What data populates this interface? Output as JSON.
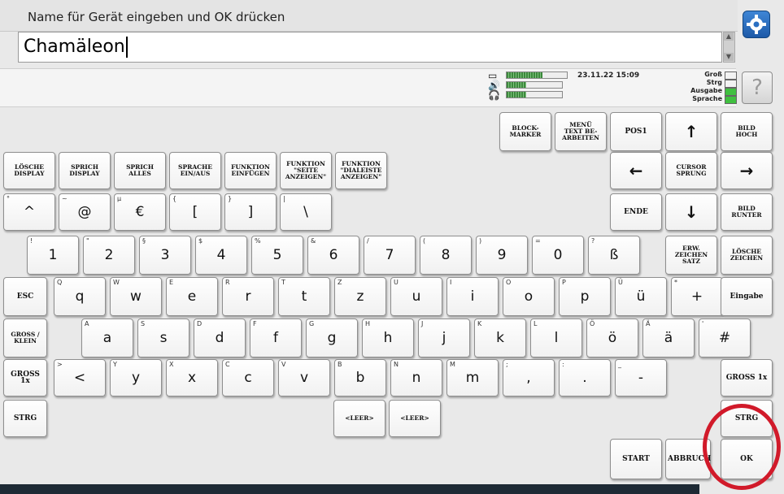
{
  "prompt": "Name für Gerät eingeben und OK drücken",
  "input_value": "Chamäleon",
  "scroll": {
    "up": "▲",
    "down": "▼"
  },
  "help_glyph": "?",
  "status": {
    "datetime": "23.11.22 15:09",
    "meters": [
      {
        "icon": "battery-icon",
        "glyph": "▭",
        "level": 0.6
      },
      {
        "icon": "speaker-icon",
        "glyph": "🔊",
        "level": 0.35
      },
      {
        "icon": "headphones-icon",
        "glyph": "🎧",
        "level": 0.35
      }
    ],
    "flags": [
      {
        "label": "Groß",
        "on": false
      },
      {
        "label": "Strg",
        "on": false
      },
      {
        "label": "Ausgabe",
        "on": true
      },
      {
        "label": "Sprache",
        "on": true
      }
    ],
    "flag_on_color": "#40c040"
  },
  "keys": {
    "block_marker": "BLOCK-\nMARKER",
    "menu_text": "MENÜ\nTEXT BE-\nARBEITEN",
    "pos1": "POS1",
    "up": "↑",
    "page_up": "BILD\nHOCH",
    "clear_display": "LÖSCHE\nDISPLAY",
    "speak_display": "SPRICH\nDISPLAY",
    "speak_all": "SPRICH\nALLES",
    "speech_toggle": "SPRACHE\nEIN/AUS",
    "insert_function": "FUNKTION\nEINFÜGEN",
    "page_function": "FUNKTION\n\"SEITE\nANZEIGEN\"",
    "dialog_function": "FUNKTION\n\"DIALEISTE\nANZEIGEN\"",
    "left": "←",
    "cursor_jump": "CURSOR\nSPRUNG",
    "right": "→",
    "end": "ENDE",
    "down": "↓",
    "page_down": "BILD\nRUNTER",
    "ext_chars": "ERW.\nZEICHEN\nSATZ",
    "delete_chars": "LÖSCHE\nZEICHEN",
    "esc": "ESC",
    "enter": "Eingabe",
    "caps": "GROSS /\nKLEIN",
    "shift_once_left": "GROSS 1x",
    "shift_once_right": "GROSS 1x",
    "ctrl_left": "STRG",
    "ctrl_right": "STRG",
    "space_1": "<LEER>",
    "space_2": "<LEER>",
    "start": "START",
    "abort": "ABBRUCH",
    "ok": "OK",
    "row0": [
      {
        "main": "^",
        "sup": "°"
      },
      {
        "main": "@",
        "sup": "~"
      },
      {
        "main": "€",
        "sup": "µ"
      },
      {
        "main": "[",
        "sup": "{"
      },
      {
        "main": "]",
        "sup": "}"
      },
      {
        "main": "\\",
        "sup": "|"
      }
    ],
    "row1": [
      {
        "main": "1",
        "sup": "!"
      },
      {
        "main": "2",
        "sup": "\""
      },
      {
        "main": "3",
        "sup": "§"
      },
      {
        "main": "4",
        "sup": "$"
      },
      {
        "main": "5",
        "sup": "%"
      },
      {
        "main": "6",
        "sup": "&"
      },
      {
        "main": "7",
        "sup": "/"
      },
      {
        "main": "8",
        "sup": "("
      },
      {
        "main": "9",
        "sup": ")"
      },
      {
        "main": "0",
        "sup": "="
      },
      {
        "main": "ß",
        "sup": "?"
      }
    ],
    "row2": [
      {
        "main": "q",
        "sup": "Q"
      },
      {
        "main": "w",
        "sup": "W"
      },
      {
        "main": "e",
        "sup": "E"
      },
      {
        "main": "r",
        "sup": "R"
      },
      {
        "main": "t",
        "sup": "T"
      },
      {
        "main": "z",
        "sup": "Z"
      },
      {
        "main": "u",
        "sup": "U"
      },
      {
        "main": "i",
        "sup": "I"
      },
      {
        "main": "o",
        "sup": "O"
      },
      {
        "main": "p",
        "sup": "P"
      },
      {
        "main": "ü",
        "sup": "Ü"
      },
      {
        "main": "+",
        "sup": "*"
      }
    ],
    "row3": [
      {
        "main": "a",
        "sup": "A"
      },
      {
        "main": "s",
        "sup": "S"
      },
      {
        "main": "d",
        "sup": "D"
      },
      {
        "main": "f",
        "sup": "F"
      },
      {
        "main": "g",
        "sup": "G"
      },
      {
        "main": "h",
        "sup": "H"
      },
      {
        "main": "j",
        "sup": "J"
      },
      {
        "main": "k",
        "sup": "K"
      },
      {
        "main": "l",
        "sup": "L"
      },
      {
        "main": "ö",
        "sup": "Ö"
      },
      {
        "main": "ä",
        "sup": "Ä"
      },
      {
        "main": "#",
        "sup": "'"
      }
    ],
    "row4": [
      {
        "main": "<",
        "sup": ">"
      },
      {
        "main": "y",
        "sup": "Y"
      },
      {
        "main": "x",
        "sup": "X"
      },
      {
        "main": "c",
        "sup": "C"
      },
      {
        "main": "v",
        "sup": "V"
      },
      {
        "main": "b",
        "sup": "B"
      },
      {
        "main": "n",
        "sup": "N"
      },
      {
        "main": "m",
        "sup": "M"
      },
      {
        "main": ",",
        "sup": ";"
      },
      {
        "main": ".",
        "sup": ":"
      },
      {
        "main": "-",
        "sup": "_"
      }
    ]
  }
}
